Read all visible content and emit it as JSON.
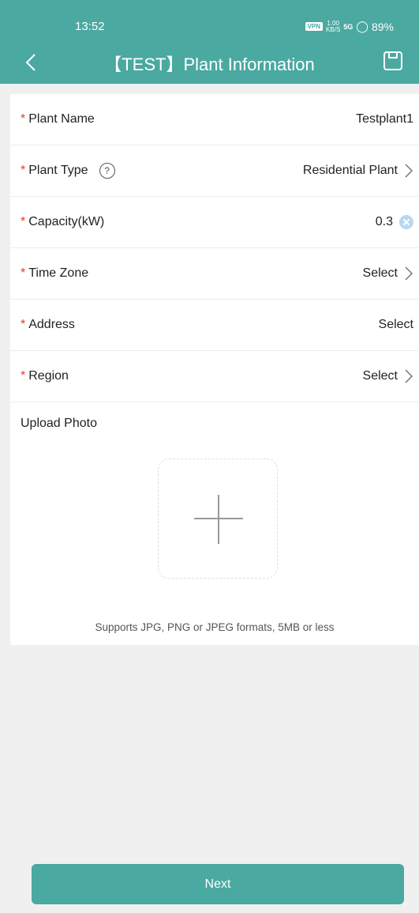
{
  "status_bar": {
    "time": "13:52",
    "vpn": "VPN",
    "speed": "1.00",
    "speed_unit": "KB/S",
    "network": "5G",
    "battery": "89%"
  },
  "header": {
    "title": "【TEST】Plant Information",
    "color": "#4aa9a1"
  },
  "form": {
    "plant_name": {
      "label": "Plant Name",
      "value": "Testplant1"
    },
    "plant_type": {
      "label": "Plant Type",
      "value": "Residential Plant"
    },
    "capacity": {
      "label": "Capacity(kW)",
      "value": "0.3"
    },
    "time_zone": {
      "label": "Time Zone",
      "value": "Select"
    },
    "address": {
      "label": "Address",
      "value": "Select"
    },
    "region": {
      "label": "Region",
      "value": "Select"
    }
  },
  "upload": {
    "label": "Upload Photo",
    "hint": "Supports JPG, PNG or JPEG formats, 5MB or less"
  },
  "next_label": "Next"
}
